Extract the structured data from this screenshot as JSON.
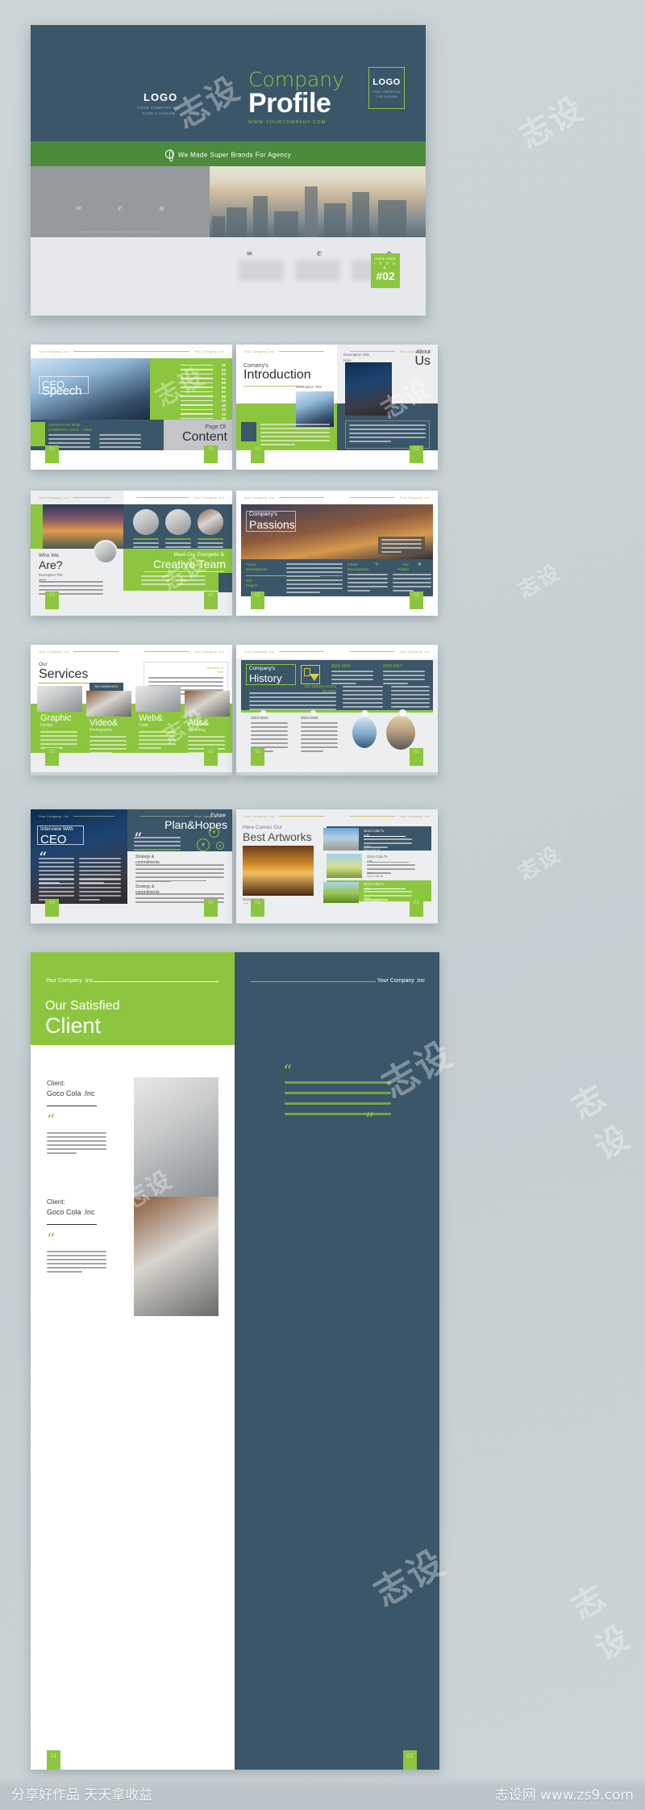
{
  "meta": {
    "accent_green": "#8cc63e",
    "accent_navy": "#3b5668",
    "band_green": "#4b8b3b",
    "page_bg": "#ccd4d6"
  },
  "cover": {
    "logo_left": "LOGO",
    "logo_left_sub": "YOUR COMPANY INC\nCJSD 1-1234SW",
    "title_line1": "Company",
    "title_line2": "Profile",
    "website": "WWW.YOURCOMPANY.COM",
    "logo_box": "LOGO",
    "logo_box_sub": "YOUR COMPANY INC\nCJSD 6-1234SW",
    "band_text": "We Made Super Brands For Agency",
    "band_icon": "globe-search-icon",
    "back_url": "WWW.YOURCOMPANYWEBSITE.COM",
    "contact_icons": [
      "mail-icon",
      "phone-icon",
      "globe-icon"
    ],
    "issue_years": "2024-2025",
    "issue_label": "I S S U E",
    "issue_number": "#02"
  },
  "spreads": [
    {
      "name": "speech-content",
      "left": {
        "header_left": "Your Company .Inc",
        "header_right": "Your Company .Inc",
        "hero_small": "CEO",
        "hero_big": "Speech",
        "toc_items": [
          "01",
          "02",
          "03",
          "04",
          "05",
          "06",
          "07",
          "08",
          "09",
          "10",
          "11",
          "12",
          "13",
          "14"
        ],
        "toc_label": "content here",
        "signature_name": "JONATHAN DOE",
        "signature_role": "COMPANY CEO . ASIA"
      },
      "right": {
        "page_of": "Page Of",
        "page_title": "Content"
      },
      "page_left_num": "01",
      "page_right_num": "02"
    },
    {
      "name": "introduction-about",
      "left": {
        "header_left": "Your Company .Inc",
        "kicker": "Comany's",
        "title": "Introduction",
        "caption": "Description Title\nHere"
      },
      "right": {
        "header_right": "Your Company .Inc",
        "kicker": "About",
        "title": "Us",
        "caption": "Description Title\nHere"
      },
      "page_left_num": "01",
      "page_right_num": "02"
    },
    {
      "name": "whoweare-creativeteam",
      "left": {
        "header_left": "Your Company .Inc",
        "kicker": "Who We",
        "title": "Are?",
        "caption": "Description Title\nHere"
      },
      "right": {
        "header_right": "Your Company .Inc",
        "kicker": "Meet Our Energetic &",
        "title": "Creative Team"
      },
      "page_left_num": "01",
      "page_right_num": "02"
    },
    {
      "name": "passions",
      "left": {
        "header_left": "Your Company .Inc",
        "kicker": "Company's",
        "title": "Passions"
      },
      "right": {
        "header_right": "Your Company .Inc",
        "blocks": [
          "Future\nDevelopment",
          "Our\nProject",
          "Future\nDevelopment",
          "Our\nProject"
        ]
      },
      "page_left_num": "01",
      "page_right_num": "02"
    },
    {
      "name": "services-history",
      "left": {
        "header_left": "Your Company .Inc",
        "header_right": "Your Company .Inc",
        "kicker": "Our",
        "title": "Services",
        "note": "This serve us\nhere",
        "badge": "RECOMMENDED",
        "cards": [
          {
            "title": "Graphic",
            "sub": "Design"
          },
          {
            "title": "Video&",
            "sub": "Photography"
          },
          {
            "title": "Web&",
            "sub": "Code"
          },
          {
            "title": "Ads&",
            "sub": "Marketing"
          }
        ]
      },
      "right": {
        "header_left": "Your Company .Inc",
        "header_right": "Your Company .Inc",
        "kicker": "Company's",
        "title": "History",
        "icon": "calendar-download-icon",
        "years_top": [
          "2015-2016",
          "2016-2017"
        ],
        "journey_label": "Our Journey Across\n10 Years",
        "years_bottom": [
          "2023-2024",
          "2024-2025"
        ]
      },
      "page_left_num": "01",
      "page_right_num": "02"
    },
    {
      "name": "ceo-plans",
      "left": {
        "header_left": "Your Company .Inc",
        "header_right": "Your Company .Inc",
        "kicker": "Interview With",
        "title": "CEO"
      },
      "right": {
        "kicker": "Future",
        "title": "Plan&Hopes",
        "quote_icon": "quote-icon",
        "sections": [
          "Strategy &\ncommitments",
          "Strategy &\ncommitments"
        ]
      },
      "page_left_num": "01",
      "page_right_num": "02"
    },
    {
      "name": "best-artworks",
      "left": {
        "header_left": "Your Company .Inc",
        "header_right": "Your Company .Inc",
        "kicker": "Here Comes Our",
        "title": "Best Artworks",
        "caption_title": "Goco Cola Tv\nAds",
        "caption_sub": "Client\nGoco Cola Inc"
      },
      "right": {
        "header_left": "Your Company .Inc",
        "header_right": "Your Company .Inc",
        "items": [
          {
            "title": "Goco Cola Tv\nAds",
            "sub": "Client\nGoco Cola Inc",
            "style": "navy"
          },
          {
            "title": "Goco Cola Tv\nAds",
            "sub": "Client\nGoco Cola Inc",
            "style": "white"
          },
          {
            "title": "Goco Cola Tv\nAds",
            "sub": "Client\nGoco Cola Inc",
            "style": "green"
          }
        ]
      },
      "page_left_num": "01",
      "page_right_num": "02"
    }
  ],
  "client_spread": {
    "name": "satisfied-client",
    "header_left": "Your Company .Inc",
    "header_right": "Your Company .Inc",
    "kicker": "Our Satisfied",
    "title": "Client",
    "clients": [
      {
        "label": "Client:",
        "name": "Goco Cola .Inc"
      },
      {
        "label": "Client:",
        "name": "Goco Cola .Inc"
      }
    ],
    "quote_open": "“",
    "quote_close": "”",
    "page_left_num": "01",
    "page_right_num": "02"
  },
  "watermark": "志设",
  "footer": {
    "left": "分享好作品 天天拿收益",
    "right": "志设网 www.zs9.com"
  }
}
